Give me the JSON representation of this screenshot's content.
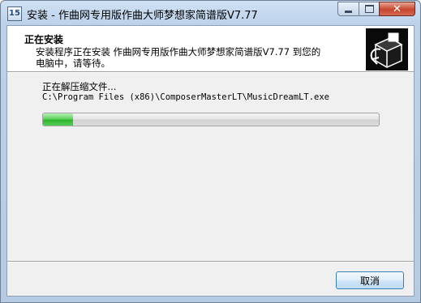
{
  "window": {
    "title": "安装 - 作曲网专用版作曲大师梦想家简谱版V7.77",
    "app_icon_glyph": "15"
  },
  "header": {
    "title": "正在安装",
    "description": "安装程序正在安装 作曲网专用版作曲大师梦想家简谱版V7.77 到您的电脑中，请等待。",
    "icon": "installer-computer-icon"
  },
  "status": {
    "label": "正在解压缩文件...",
    "path": "C:\\Program Files (x86)\\ComposerMasterLT\\MusicDreamLT.exe"
  },
  "progress": {
    "fraction": 0.09
  },
  "footer": {
    "cancel_label": "取消"
  },
  "colors": {
    "progress_fill": "#3fbf3f",
    "header_bg": "#ffffff",
    "client_bg": "#f0f0f0",
    "close_button": "#c7462f"
  }
}
